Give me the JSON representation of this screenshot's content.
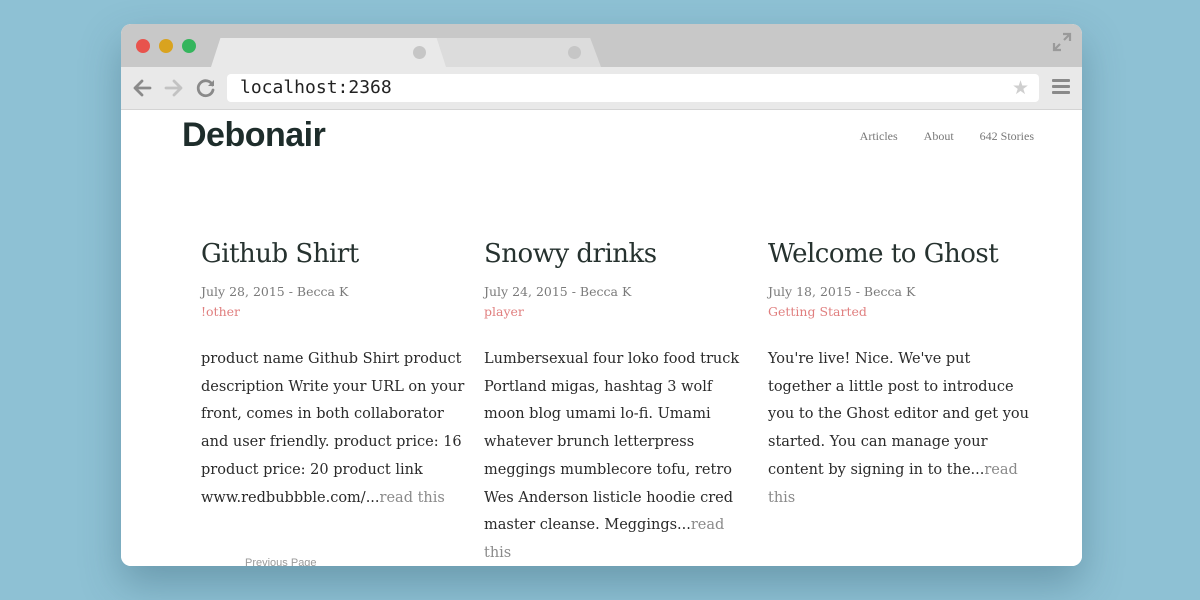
{
  "browser": {
    "url": "localhost:2368"
  },
  "site": {
    "title": "Debonair",
    "nav": [
      "Articles",
      "About",
      "642 Stories"
    ]
  },
  "posts": [
    {
      "title": "Github Shirt",
      "meta": "July 28, 2015 - Becca K",
      "tag": "!other",
      "excerpt": "product name Github Shirt product description Write your URL on your front, comes in both collaborator and user friendly. product price: 16 product price: 20 product link www.redbubbble.com/...",
      "read_more": "read this"
    },
    {
      "title": "Snowy drinks",
      "meta": "July 24, 2015 - Becca K",
      "tag": "player",
      "excerpt": "Lumbersexual four loko food truck Portland migas, hashtag 3 wolf moon blog umami lo-fi. Umami whatever brunch letterpress meggings mumblecore tofu, retro Wes Anderson listicle hoodie cred master cleanse. Meggings...",
      "read_more": "read this"
    },
    {
      "title": "Welcome to Ghost",
      "meta": "July 18, 2015 - Becca K",
      "tag": "Getting Started",
      "excerpt": "You're live! Nice. We've put together a little post to introduce you to the Ghost editor and get you started. You can manage your content by signing in to the...",
      "read_more": "read this"
    }
  ],
  "pagination": {
    "label": "Previous Page"
  },
  "colors": {
    "background": "#8ec1d4",
    "tag": "#e07f7f",
    "title": "#26322f"
  }
}
